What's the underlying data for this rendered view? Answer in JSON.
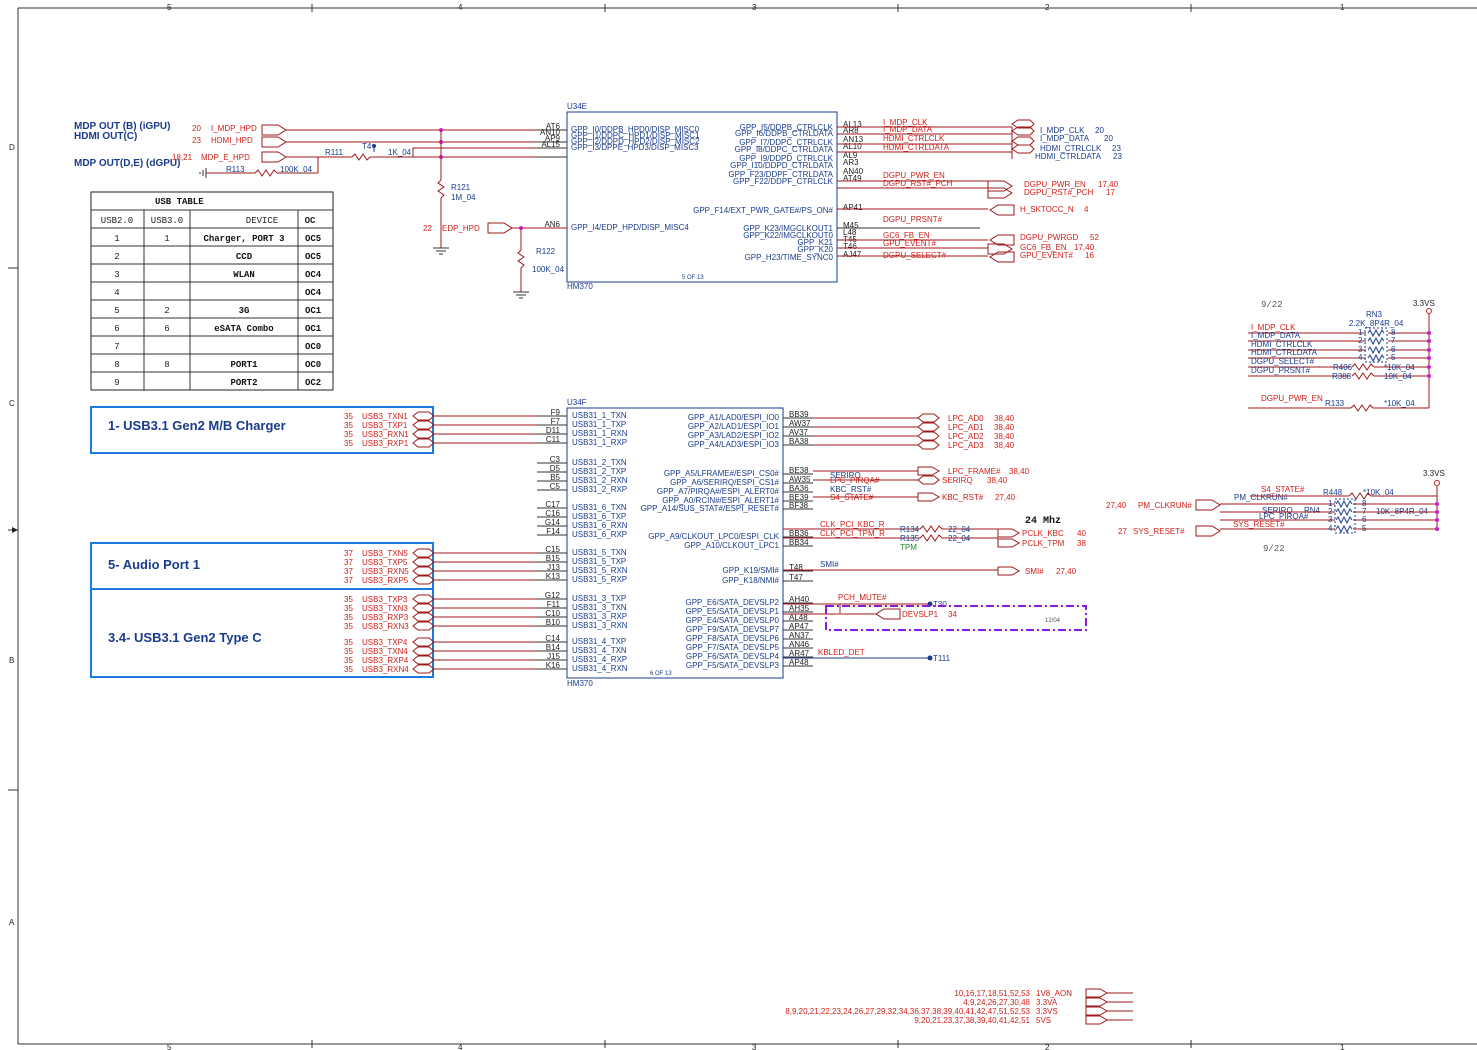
{
  "frame": {
    "cols_top": [
      "5",
      "4",
      "3",
      "2",
      "1"
    ],
    "cols_bottom": [
      "5",
      "4",
      "3",
      "2",
      "1"
    ],
    "rows": [
      "D",
      "C",
      "B",
      "A"
    ]
  },
  "u34e": {
    "ref": "U34E",
    "part": "HM370",
    "page": "5 OF 13",
    "left_pins": [
      {
        "num": "AT6",
        "name": "GPP_I0/DDPB_HPD0/DISP_MISC0"
      },
      {
        "num": "AN10",
        "name": "GPP_I1/DDPC_HPD1/DISP_MISC1"
      },
      {
        "num": "AP9",
        "name": "GPP_I2/DDPD_HPD2/DISP_MISC2"
      },
      {
        "num": "AL15",
        "name": "GPP_I3/DPPE_HPD3/DISP_MISC3"
      },
      {
        "num": "AN6",
        "name": "GPP_I4/EDP_HPD/DISP_MISC4"
      }
    ],
    "right_pins": [
      {
        "num": "AL13",
        "name": "GPP_I5/DDPB_CTRLCLK"
      },
      {
        "num": "AR8",
        "name": "GPP_I6/DDPB_CTRLDATA"
      },
      {
        "num": "AN13",
        "name": "GPP_I7/DDPC_CTRLCLK"
      },
      {
        "num": "AL10",
        "name": "GPP_I8/DDPC_CTRLDATA"
      },
      {
        "num": "AL9",
        "name": "GPP_I9/DDPD_CTRLCLK"
      },
      {
        "num": "AR3",
        "name": "GPP_I10/DDPD_CTRLDATA"
      },
      {
        "num": "AN40",
        "name": "GPP_F23/DDPF_CTRLDATA"
      },
      {
        "num": "AT49",
        "name": "GPP_F22/DDPF_CTRLCLK"
      },
      {
        "num": "AP41",
        "name": "GPP_F14/EXT_PWR_GATE#/PS_ON#"
      },
      {
        "num": "M45",
        "name": "GPP_K23/IMGCLKOUT1"
      },
      {
        "num": "L48",
        "name": "GPP_K22/IMGCLKOUT0"
      },
      {
        "num": "T45",
        "name": "GPP_K21"
      },
      {
        "num": "T46",
        "name": "GPP_K20"
      },
      {
        "num": "AJ47",
        "name": "GPP_H23/TIME_SYNC0"
      }
    ]
  },
  "u34f": {
    "ref": "U34F",
    "part": "HM370",
    "page": "6 OF 13",
    "left_pins": [
      {
        "num": "F9",
        "name": "USB31_1_TXN"
      },
      {
        "num": "F7",
        "name": "USB31_1_TXP"
      },
      {
        "num": "D11",
        "name": "USB31_1_RXN"
      },
      {
        "num": "C11",
        "name": "USB31_1_RXP"
      },
      {
        "num": "C3",
        "name": "USB31_2_TXN"
      },
      {
        "num": "D5",
        "name": "USB31_2_TXP"
      },
      {
        "num": "B5",
        "name": "USB31_2_RXN"
      },
      {
        "num": "C5",
        "name": "USB31_2_RXP"
      },
      {
        "num": "C17",
        "name": "USB31_6_TXN"
      },
      {
        "num": "C16",
        "name": "USB31_6_TXP"
      },
      {
        "num": "G14",
        "name": "USB31_6_RXN"
      },
      {
        "num": "F14",
        "name": "USB31_6_RXP"
      },
      {
        "num": "C15",
        "name": "USB31_5_TXN"
      },
      {
        "num": "B15",
        "name": "USB31_5_TXP"
      },
      {
        "num": "J13",
        "name": "USB31_5_RXN"
      },
      {
        "num": "K13",
        "name": "USB31_5_RXP"
      },
      {
        "num": "G12",
        "name": "USB31_3_TXP"
      },
      {
        "num": "F11",
        "name": "USB31_3_TXN"
      },
      {
        "num": "C10",
        "name": "USB31_3_RXP"
      },
      {
        "num": "B10",
        "name": "USB31_3_RXN"
      },
      {
        "num": "C14",
        "name": "USB31_4_TXP"
      },
      {
        "num": "B14",
        "name": "USB31_4_TXN"
      },
      {
        "num": "J15",
        "name": "USB31_4_RXP"
      },
      {
        "num": "K16",
        "name": "USB31_4_RXN"
      }
    ],
    "right_pins": [
      {
        "num": "BB39",
        "name": "GPP_A1/LAD0/ESPI_IO0"
      },
      {
        "num": "AW37",
        "name": "GPP_A2/LAD1/ESPI_IO1"
      },
      {
        "num": "AV37",
        "name": "GPP_A3/LAD2/ESPI_IO2"
      },
      {
        "num": "BA38",
        "name": "GPP_A4/LAD3/ESPI_IO3"
      },
      {
        "num": "BE38",
        "name": "GPP_A5/LFRAME#/ESPI_CS0#"
      },
      {
        "num": "AW35",
        "name": "GPP_A6/SERIRQ/ESPI_CS1#"
      },
      {
        "num": "BA36",
        "name": "GPP_A7/PIRQA#/ESPI_ALERT0#"
      },
      {
        "num": "BE39",
        "name": "GPP_A0/RCIN#/ESPI_ALERT1#"
      },
      {
        "num": "BF38",
        "name": "GPP_A14/SUS_STAT#/ESPI_RESET#"
      },
      {
        "num": "BB36",
        "name": "GPP_A9/CLKOUT_LPC0/ESPI_CLK"
      },
      {
        "num": "BB34",
        "name": "GPP_A10/CLKOUT_LPC1"
      },
      {
        "num": "T48",
        "name": "GPP_K19/SMI#"
      },
      {
        "num": "T47",
        "name": "GPP_K18/NMI#"
      },
      {
        "num": "AH40",
        "name": "GPP_E6/SATA_DEVSLP2"
      },
      {
        "num": "AH35",
        "name": "GPP_E5/SATA_DEVSLP1"
      },
      {
        "num": "AL48",
        "name": "GPP_E4/SATA_DEVSLP0"
      },
      {
        "num": "AP47",
        "name": "GPP_F9/SATA_DEVSLP7"
      },
      {
        "num": "AN37",
        "name": "GPP_F8/SATA_DEVSLP6"
      },
      {
        "num": "AN46",
        "name": "GPP_F7/SATA_DEVSLP5"
      },
      {
        "num": "AR47",
        "name": "GPP_F6/SATA_DEVSLP4"
      },
      {
        "num": "AP48",
        "name": "GPP_F5/SATA_DEVSLP3"
      }
    ]
  },
  "hpd": {
    "mdp_b_label": "MDP OUT (B) (iGPU)",
    "hdmi_c_label": "HDMI OUT(C)",
    "mdp_de_label": "MDP OUT(D,E) (dGPU)",
    "i_mdp_hpd": {
      "page": "20",
      "net": "I_MDP_HPD"
    },
    "hdmi_hpd": {
      "page": "23",
      "net": "HDMI_HPD"
    },
    "mdp_e_hpd": {
      "page": "18,21",
      "net": "MDP_E_HPD"
    },
    "edp_hpd": {
      "page": "22",
      "net": "EDP_HPD"
    },
    "r111": "R111",
    "t4": "T4",
    "r111_val": "1K_04",
    "r113": "R113",
    "r113_val": "100K_04",
    "r121": "R121",
    "r121_val": "1M_04",
    "r122": "R122",
    "r122_val": "100K_04"
  },
  "gpu_nets": [
    {
      "net": "I_MDP_CLK",
      "port": "I_MDP_CLK",
      "page": "20"
    },
    {
      "net": "I_MDP_DATA",
      "port": "I_MDP_DATA",
      "page": "20"
    },
    {
      "net": "HDMI_CTRLCLK",
      "port": "HDMI_CTRLCLK",
      "page": "23"
    },
    {
      "net": "HDMI_CTRLDATA",
      "port": "HDMI_CTRLDATA",
      "page": "23"
    },
    {
      "net": "DGPU_PWR_EN",
      "port": "DGPU_PWR_EN",
      "page": "17,40"
    },
    {
      "net": "DGPU_RST#_PCH",
      "port": "DGPU_RST#_PCH",
      "page": "17"
    },
    {
      "net": "",
      "port": "H_SKTOCC_N",
      "page": "4"
    },
    {
      "net": "DGPU_PRSNT#",
      "port": "",
      "page": ""
    },
    {
      "net": "GC6_FB_EN",
      "port": "DGPU_PWRGD",
      "page": "52"
    },
    {
      "net": "GPU_EVENT#",
      "port": "GC6_FB_EN",
      "page": "17,40"
    },
    {
      "net": "DGPU_SELECT#",
      "port": "GPU_EVENT#",
      "page": "16"
    }
  ],
  "usb_table": {
    "title": "USB TABLE",
    "headers": [
      "USB2.0",
      "USB3.0",
      "DEVICE",
      "OC"
    ],
    "rows": [
      [
        "1",
        "1",
        "Charger, PORT 3",
        "OC5"
      ],
      [
        "2",
        "",
        "CCD",
        "OC5"
      ],
      [
        "3",
        "",
        "WLAN",
        "OC4"
      ],
      [
        "4",
        "",
        "",
        "OC4"
      ],
      [
        "5",
        "2",
        "3G",
        "OC1"
      ],
      [
        "6",
        "6",
        "eSATA Combo",
        "OC1"
      ],
      [
        "7",
        "",
        "",
        "OC0"
      ],
      [
        "8",
        "8",
        "PORT1",
        "OC0"
      ],
      [
        "9",
        "",
        "PORT2",
        "OC2"
      ]
    ]
  },
  "usb_blocks": [
    {
      "title": "1- USB3.1 Gen2 M/B Charger"
    },
    {
      "title": "5- Audio Port 1"
    },
    {
      "title": "3.4- USB3.1 Gen2 Type C"
    }
  ],
  "usb_nets": [
    {
      "page": "35",
      "net": "USB3_TXN1"
    },
    {
      "page": "35",
      "net": "USB3_TXP1"
    },
    {
      "page": "35",
      "net": "USB3_RXN1"
    },
    {
      "page": "35",
      "net": "USB3_RXP1"
    },
    {
      "page": "37",
      "net": "USB3_TXN5"
    },
    {
      "page": "37",
      "net": "USB3_TXP5"
    },
    {
      "page": "37",
      "net": "USB3_RXN5"
    },
    {
      "page": "37",
      "net": "USB3_RXP5"
    },
    {
      "page": "35",
      "net": "USB3_TXP3"
    },
    {
      "page": "35",
      "net": "USB3_TXN3"
    },
    {
      "page": "35",
      "net": "USB3_RXP3"
    },
    {
      "page": "35",
      "net": "USB3_RXN3"
    },
    {
      "page": "35",
      "net": "USB3_TXP4"
    },
    {
      "page": "35",
      "net": "USB3_TXN4"
    },
    {
      "page": "35",
      "net": "USB3_RXP4"
    },
    {
      "page": "35",
      "net": "USB3_RXN4"
    }
  ],
  "lpc_ports": [
    {
      "port": "LPC_AD0",
      "page": "38,40"
    },
    {
      "port": "LPC_AD1",
      "page": "38,40"
    },
    {
      "port": "LPC_AD2",
      "page": "38,40"
    },
    {
      "port": "LPC_AD3",
      "page": "38,40"
    },
    {
      "port": "LPC_FRAME#",
      "page": "38,40"
    },
    {
      "port": "SERIRQ",
      "page": "38,40"
    },
    {
      "port": "KBC_RST#",
      "page": "27,40"
    },
    {
      "port": "PCLK_KBC",
      "page": "40"
    },
    {
      "port": "PCLK_TPM",
      "page": "38"
    },
    {
      "port": "SMI#",
      "page": "27,40"
    }
  ],
  "lpc_nets": {
    "serirq": "SERIRQ",
    "lpc_pirqa": "LPC_PIRQA#",
    "kbc_rst": "KBC_RST#",
    "s4_state": "S4_STATE#",
    "clk_kbc": "CLK_PCI_KBC_R",
    "clk_tpm": "CLK_PCI_TPM_R",
    "r134": "R134",
    "r135": "R135",
    "r134_val": "22_04",
    "r135_val": "22_04",
    "tpm": "TPM",
    "freq": "24 Mhz",
    "smi": "SMI#",
    "pch_mute": "PCH_MUTE#",
    "t30": "T30",
    "devslp1": "DEVSLP1",
    "devslp1_page": "34",
    "kbled": "KBLED_DET",
    "t111": "T111",
    "note_date": "12/04"
  },
  "rn3_block": {
    "date": "9/22",
    "rail": "3.3VS",
    "ref": "RN3",
    "value": "2.2K_8P4R_04",
    "nets": [
      "I_MDP_CLK",
      "I_MDP_DATA",
      "HDMI_CTRLCLK",
      "HDMI_CTRLDATA",
      "DGPU_SELECT#",
      "DGPU_PRSNT#"
    ],
    "pins_left": [
      "1",
      "2",
      "3",
      "4"
    ],
    "pins_right": [
      "8",
      "7",
      "6",
      "5"
    ],
    "r406": "R406",
    "r406_val": "*10K_04",
    "r388": "R388",
    "r388_val": "10K_04",
    "pwr_en": "DGPU_PWR_EN",
    "r133": "R133",
    "r133_val": "*10K_04"
  },
  "rn4_block": {
    "rail": "3.3VS",
    "date": "9/22",
    "s4_state": "S4_STATE#",
    "pm_clkrun_net": "PM_CLKRUN#",
    "serirq": "SERIRQ",
    "lpc_pirqa": "LPC_PIRQA#",
    "sys_reset_net": "SYS_RESET#",
    "r448": "R448",
    "r448_val": "*10K_04",
    "rn4": "RN4",
    "rn4_val": "10K_8P4R_04",
    "pm_clkrun_page": "27,40",
    "pm_clkrun": "PM_CLKRUN#",
    "sys_reset_page": "27",
    "sys_reset": "SYS_RESET#",
    "pins_left": [
      "1",
      "2",
      "3",
      "4"
    ],
    "pins_right": [
      "8",
      "7",
      "6",
      "5"
    ]
  },
  "power_rails": [
    {
      "pages": "10,16,17,18,51,52,53",
      "rail": "1V8_AON"
    },
    {
      "pages": "4,9,24,26,27,30,48",
      "rail": "3.3VA"
    },
    {
      "pages": "8,9,20,21,22,23,24,26,27,29,32,34,36,37,38,39,40,41,42,47,51,52,53",
      "rail": "3.3VS"
    },
    {
      "pages": "9,20,21,23,37,38,39,40,41,42,51",
      "rail": "5VS"
    }
  ]
}
